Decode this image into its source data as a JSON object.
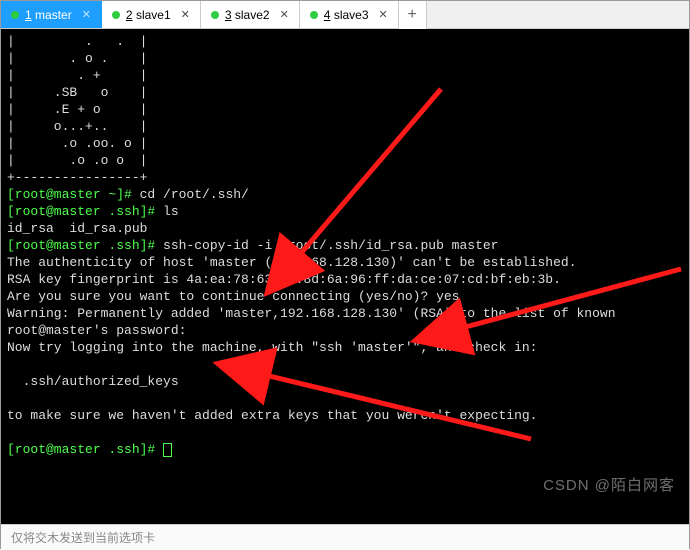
{
  "tabs": [
    {
      "num": "1",
      "label": " master"
    },
    {
      "num": "2",
      "label": " slave1"
    },
    {
      "num": "3",
      "label": " slave2"
    },
    {
      "num": "4",
      "label": " slave3"
    }
  ],
  "addtab": "+",
  "ascii": {
    "l1": "|         .   .  |",
    "l2": "|       . o .    |",
    "l3": "|        . +     |",
    "l4": "|     .SB   o    |",
    "l5": "|     .E + o     |",
    "l6": "|     o...+..    |",
    "l7": "|      .o .oo. o |",
    "l8": "|       .o .o o  |",
    "l9": "+----------------+"
  },
  "p1_user": "[root@master ~]# ",
  "p1_cmd": "cd /root/.ssh/",
  "p2_user": "[root@master .ssh]# ",
  "p2_cmd": "ls",
  "ls_out": "id_rsa  id_rsa.pub",
  "p3_user": "[root@master .ssh]# ",
  "p3_cmd": "ssh-copy-id -i /root/.ssh/id_rsa.pub master",
  "auth1": "The authenticity of host 'master (192.168.128.130)' can't be established.",
  "auth2": "RSA key fingerprint is 4a:ea:78:63:ca:8d:6a:96:ff:da:ce:07:cd:bf:eb:3b.",
  "auth3a": "Are you sure you want to continue connecting (yes/no)? ",
  "auth3b": "yes",
  "warn": "Warning: Permanently added 'master,192.168.128.130' (RSA) to the list of known",
  "pwprompt": "root@master's password: ",
  "try1": "Now try logging into the machine, with \"ssh 'master'\", and check in:",
  "try2": "  .ssh/authorized_keys",
  "try3": "to make sure we haven't added extra keys that you weren't expecting.",
  "pend": "[root@master .ssh]# ",
  "watermark": "CSDN @陌白网客",
  "bottom": "仅将交木发送到当前选项卡"
}
